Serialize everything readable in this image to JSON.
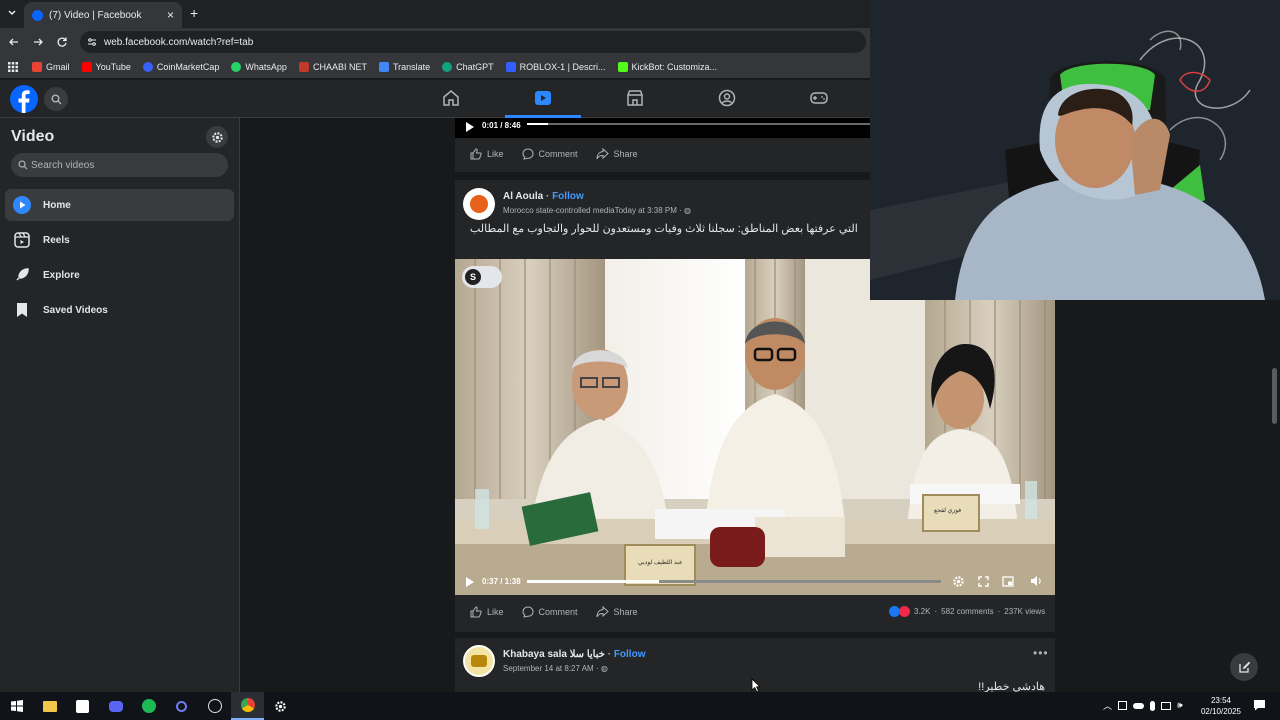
{
  "browser": {
    "tab_title": "(7) Video | Facebook",
    "url": "web.facebook.com/watch?ref=tab",
    "bookmarks": [
      {
        "label": "Gmail",
        "color": "#ea4335"
      },
      {
        "label": "YouTube",
        "color": "#ff0000"
      },
      {
        "label": "CoinMarketCap",
        "color": "#3861fb"
      },
      {
        "label": "WhatsApp",
        "color": "#25d366"
      },
      {
        "label": "CHAABI NET",
        "color": "#c0392b"
      },
      {
        "label": "Translate",
        "color": "#4285f4"
      },
      {
        "label": "ChatGPT",
        "color": "#10a37f"
      },
      {
        "label": "ROBLOX-1 | Descri...",
        "color": "#335fff"
      },
      {
        "label": "KickBot: Customiza...",
        "color": "#53fc18"
      }
    ]
  },
  "sidebar": {
    "title": "Video",
    "search_placeholder": "Search videos",
    "items": [
      {
        "label": "Home",
        "icon": "play-icon"
      },
      {
        "label": "Reels",
        "icon": "reels-icon"
      },
      {
        "label": "Explore",
        "icon": "rocket-icon"
      },
      {
        "label": "Saved Videos",
        "icon": "bookmark-icon"
      }
    ]
  },
  "posts": [
    {
      "time": "0:01 / 8:46",
      "actions": {
        "like": "Like",
        "comment": "Comment",
        "share": "Share"
      }
    },
    {
      "author": "Al Aoula",
      "follow": "Follow",
      "meta": "Morocco state-controlled mediaToday at 3:38 PM",
      "caption": "التي عرفتها بعض المناطق: سجلنا ثلاث وفيات ومستعدون للحوار والتجاوب مع المطالب",
      "video_time": "0:37 / 1:38",
      "progress": 0.32,
      "actions": {
        "like": "Like",
        "comment": "Comment",
        "share": "Share"
      },
      "reactions": "3.2K",
      "comments": "582 comments",
      "views": "237K views",
      "nameplates": [
        "عبد اللطيف لوديي",
        "فوزي لقجع"
      ]
    },
    {
      "author": "Khabaya sala خبايا سلا",
      "follow": "Follow",
      "meta": "September 14 at 8:27 AM",
      "caption": "هادشي خطير!!"
    }
  ],
  "taskbar": {
    "time": "23:54",
    "date": "02/10/2025"
  },
  "colors": {
    "facebook_blue": "#0866ff",
    "link_blue": "#4599ff"
  }
}
